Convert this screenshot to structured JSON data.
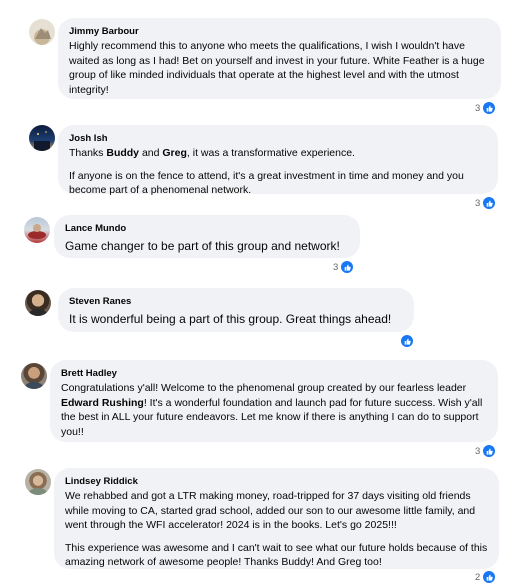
{
  "colors": {
    "bubble": "#f0f2f5",
    "like": "#1877f2",
    "count": "#65676b"
  },
  "comments": [
    {
      "author": "Jimmy Barbour",
      "text": "Highly recommend this to anyone who meets the qualifications, I wish I wouldn't have waited as long as I had! Bet on yourself and invest in your future. White Feather is a huge group of like minded individuals that operate at the highest level and with the utmost integrity!",
      "reactions": "3"
    },
    {
      "author": "Josh Ish",
      "thanks_1": "Thanks ",
      "mention_1": "Buddy",
      "thanks_2": " and ",
      "mention_2": "Greg",
      "thanks_3": ", it was a transformative experience.",
      "text_2": "If anyone is on the fence to attend, it's a great investment in time and money and you become part of a phenomenal network.",
      "reactions": "3"
    },
    {
      "author": "Lance Mundo",
      "text": "Game changer to be part of this group and network!",
      "reactions": "3"
    },
    {
      "author": "Steven Ranes",
      "text": "It is wonderful being a part of this group. Great things ahead!",
      "reactions": ""
    },
    {
      "author": "Brett Hadley",
      "text_1": "Congratulations y'all! Welcome to the phenomenal group created by our fearless leader ",
      "mention": "Edward Rushing",
      "text_2": "! It's a wonderful foundation and launch pad for future success. Wish y'all the best in ALL your future endeavors. Let me know if there is anything I can do to support you!!",
      "reactions": "3"
    },
    {
      "author": "Lindsey Riddick",
      "text": "We rehabbed and got a LTR making money, road-tripped for 37 days visiting old friends while moving to CA, started grad school, added our son to our awesome little family, and went through the WFI accelerator! 2024 is in the books. Let's go 2025!!!",
      "text_2": "This experience was awesome and I can't wait to see what our future holds because of this amazing network of awesome people! Thanks Buddy! And Greg too!",
      "reactions": "2"
    }
  ]
}
